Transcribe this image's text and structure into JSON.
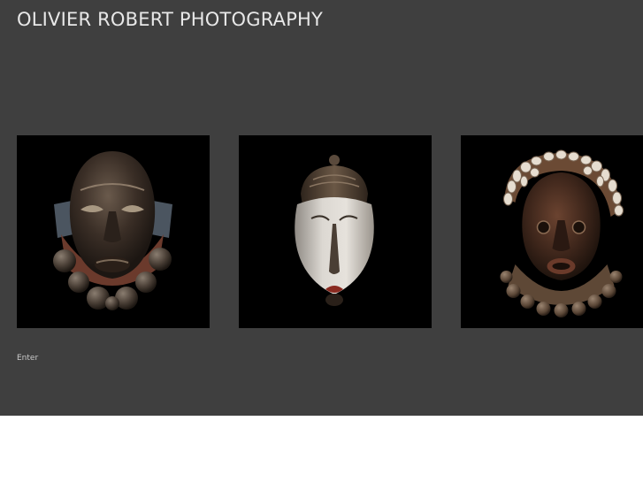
{
  "header": {
    "title": "OLIVIER ROBERT PHOTOGRAPHY"
  },
  "gallery": {
    "items": [
      {
        "subject": "dark wooden mask with metal bell beads"
      },
      {
        "subject": "white-faced wooden mask with crest"
      },
      {
        "subject": "wooden mask with cowrie shell headdress"
      }
    ]
  },
  "nav": {
    "enter_label": "Enter"
  },
  "colors": {
    "page_background": "#3f3f3f",
    "photo_background": "#000000",
    "title_text": "#e8e8e8",
    "link_text": "#c9c9c9",
    "below_page": "#ffffff"
  }
}
